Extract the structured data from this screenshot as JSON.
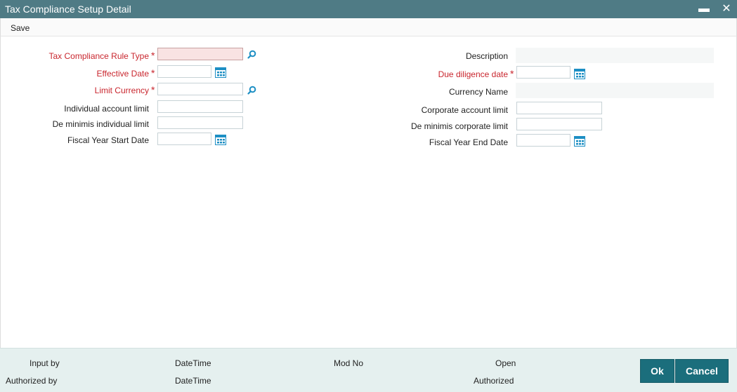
{
  "window": {
    "title": "Tax Compliance Setup Detail",
    "minimize_glyph": "▬",
    "close_glyph": "✕"
  },
  "toolbar": {
    "save_label": "Save"
  },
  "form": {
    "required_marker": "*",
    "left": {
      "tax_rule_type": {
        "label": "Tax Compliance Rule Type",
        "value": "",
        "required": true
      },
      "effective_date": {
        "label": "Effective Date",
        "value": "",
        "required": true
      },
      "limit_currency": {
        "label": "Limit Currency",
        "value": "",
        "required": true
      },
      "individual_account_limit": {
        "label": "Individual account limit",
        "value": ""
      },
      "de_minimis_individual_limit": {
        "label": "De minimis individual limit",
        "value": ""
      },
      "fiscal_year_start_date": {
        "label": "Fiscal Year Start Date",
        "value": ""
      }
    },
    "right": {
      "description": {
        "label": "Description",
        "value": ""
      },
      "due_diligence_date": {
        "label": "Due diligence date",
        "value": "",
        "required": true
      },
      "currency_name": {
        "label": "Currency Name",
        "value": ""
      },
      "corporate_account_limit": {
        "label": "Corporate account limit",
        "value": ""
      },
      "de_minimis_corporate_limit": {
        "label": "De minimis corporate limit",
        "value": ""
      },
      "fiscal_year_end_date": {
        "label": "Fiscal Year End Date",
        "value": ""
      }
    }
  },
  "footer": {
    "input_by": "Input by",
    "authorized_by": "Authorized by",
    "datetime_1": "DateTime",
    "datetime_2": "DateTime",
    "mod_no": "Mod No",
    "open": "Open",
    "authorized": "Authorized",
    "ok_label": "Ok",
    "cancel_label": "Cancel"
  },
  "colors": {
    "titlebar": "#4f7b85",
    "required": "#c9262e",
    "icon_accent": "#1d8fc4",
    "button": "#1b6e7c",
    "footer": "#e5f0ef"
  },
  "icons": {
    "lookup": "search-icon",
    "date": "calendar-icon"
  }
}
